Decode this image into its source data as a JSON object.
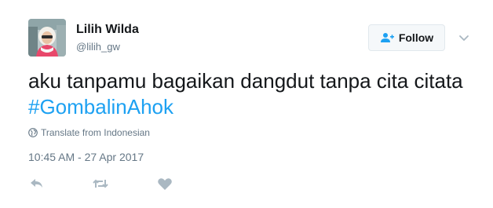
{
  "author": {
    "display_name": "Lilih Wilda",
    "username": "@lilih_gw"
  },
  "follow_button": {
    "label": "Follow"
  },
  "tweet": {
    "text": "aku tanpamu bagaikan dangdut tanpa cita citata",
    "hashtag": "#GombalinAhok",
    "translate_label": "Translate from Indonesian",
    "timestamp": "10:45 AM - 27 Apr 2017"
  },
  "icons": {
    "avatar": "profile-photo",
    "follow": "add-user-icon",
    "more": "chevron-down-icon",
    "translate": "globe-icon",
    "reply": "reply-icon",
    "retweet": "retweet-icon",
    "like": "heart-icon"
  },
  "colors": {
    "text": "#14171a",
    "secondary": "#657786",
    "link": "#1da1f2",
    "icon": "#aab8c2",
    "button_bg": "#f5f8fa",
    "button_border": "#e1e8ed"
  }
}
